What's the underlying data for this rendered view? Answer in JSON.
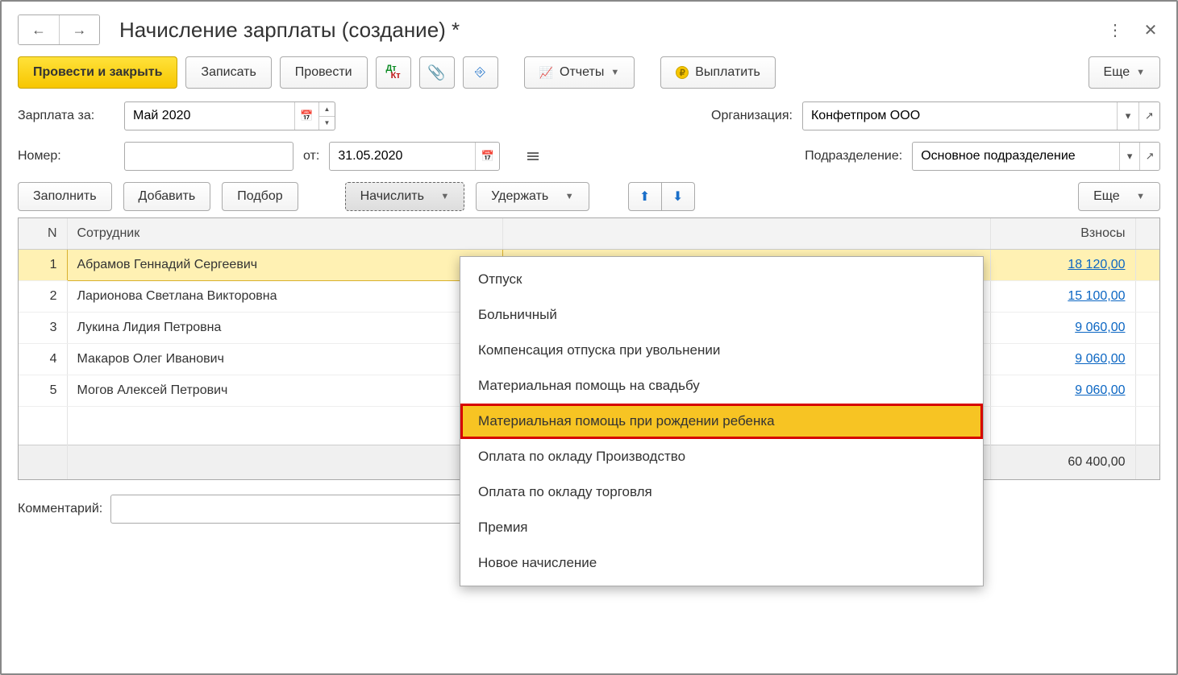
{
  "title": "Начисление зарплаты (создание) *",
  "toolbar": {
    "post_close": "Провести и закрыть",
    "save": "Записать",
    "post": "Провести",
    "reports": "Отчеты",
    "pay": "Выплатить",
    "more": "Еще"
  },
  "form": {
    "salary_for_label": "Зарплата за:",
    "salary_for": "Май 2020",
    "number_label": "Номер:",
    "number": "",
    "date_label": "от:",
    "date": "31.05.2020",
    "org_label": "Организация:",
    "org": "Конфетпром ООО",
    "dept_label": "Подразделение:",
    "dept": "Основное подразделение"
  },
  "tbl_toolbar": {
    "fill": "Заполнить",
    "add": "Добавить",
    "pick": "Подбор",
    "accrue": "Начислить",
    "withhold": "Удержать",
    "more": "Еще"
  },
  "columns": {
    "n": "N",
    "emp": "Сотрудник",
    "vz": "Взносы"
  },
  "rows": [
    {
      "n": "1",
      "emp": "Абрамов Геннадий Сергеевич",
      "vz": "18 120,00"
    },
    {
      "n": "2",
      "emp": "Ларионова Светлана Викторовна",
      "vz": "15 100,00"
    },
    {
      "n": "3",
      "emp": "Лукина Лидия Петровна",
      "vz": "9 060,00"
    },
    {
      "n": "4",
      "emp": "Макаров Олег Иванович",
      "vz": "9 060,00"
    },
    {
      "n": "5",
      "emp": "Могов Алексей Петрович",
      "vz": "9 060,00"
    }
  ],
  "total_vz": "60 400,00",
  "comment_label": "Комментарий:",
  "comment": "",
  "dropdown": [
    "Отпуск",
    "Больничный",
    "Компенсация отпуска при увольнении",
    "Материальная помощь на свадьбу",
    "Материальная помощь при рождении ребенка",
    "Оплата по окладу Производство",
    "Оплата по окладу торговля",
    "Премия",
    "Новое начисление"
  ],
  "dropdown_highlight_index": 4
}
